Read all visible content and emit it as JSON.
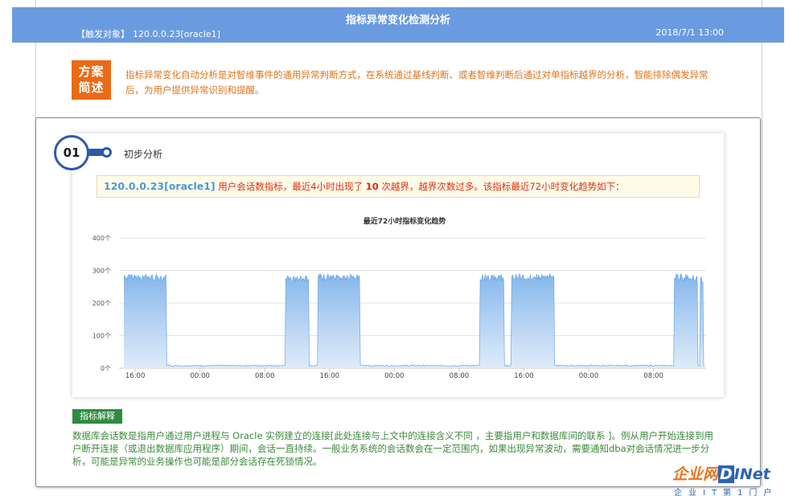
{
  "header": {
    "title": "指标异常变化检测分析",
    "target_tag": "【触发对象】",
    "target_value": "120.0.0.23[oracle1]",
    "timestamp": "2018/7/1 13:00"
  },
  "summary": {
    "badge_line1": "方案",
    "badge_line2": "简述",
    "text": "指标异常变化自动分析是对智维事件的通用异常判断方式，在系统通过基线判断、或者智维判断后通过对单指标越界的分析，智能排除偶发异常后，为用户提供异常识别和提醒。"
  },
  "step": {
    "number": "01",
    "title": "初步分析"
  },
  "alert": {
    "ip": "120.0.0.23[oracle1]",
    "text_before": " 用户会话数指标，最近4小时出现了 ",
    "count": "10",
    "text_after": " 次越界，越界次数过多。该指标最近72小时变化趋势如下："
  },
  "chart_data": {
    "type": "area",
    "title": "最近72小时指标变化趋势",
    "xlabel": "",
    "ylabel": "",
    "ylim": [
      0,
      400
    ],
    "y_ticks": [
      "0个",
      "100个",
      "200个",
      "300个",
      "400个"
    ],
    "x_ticks": [
      "16:00",
      "00:00",
      "08:00",
      "16:00",
      "00:00",
      "08:00",
      "16:00",
      "00:00",
      "08:00"
    ],
    "x_tick_hours": [
      2,
      10,
      18,
      26,
      34,
      42,
      50,
      58,
      66
    ],
    "x_range_hours": [
      0,
      72.5
    ],
    "grid": true,
    "series_color": "#7fb3ea",
    "baseline": 8,
    "high_segments": [
      {
        "start": 0.6,
        "end": 5.8,
        "value": 290
      },
      {
        "start": 20.6,
        "end": 23.5,
        "value": 285
      },
      {
        "start": 24.6,
        "end": 29.8,
        "value": 290
      },
      {
        "start": 44.6,
        "end": 47.6,
        "value": 288
      },
      {
        "start": 48.5,
        "end": 53.8,
        "value": 290
      },
      {
        "start": 68.6,
        "end": 71.5,
        "value": 290
      },
      {
        "start": 71.8,
        "end": 72.2,
        "value": 280
      }
    ]
  },
  "metric": {
    "tag": "指标解释",
    "text": "数据库会话数是指用户通过用户进程与 Oracle 实例建立的连接[此处连接与上文中的连接含义不同 ，主要指用户和数据库间的联系 ]。例从用户开始连接到用户断开连接（或退出数据库应用程序）期间，会话一直持续。一般业务系统的会话数会在一定范围内，如果出现异常波动，需要通知dba对会话情况进一步分析，可能是异常的业务操作也可能是部分会话存在死锁情况。"
  },
  "watermark": {
    "cn": "企业网",
    "d": "D",
    "net": "INet",
    "sub": "企业IT第1门户"
  }
}
